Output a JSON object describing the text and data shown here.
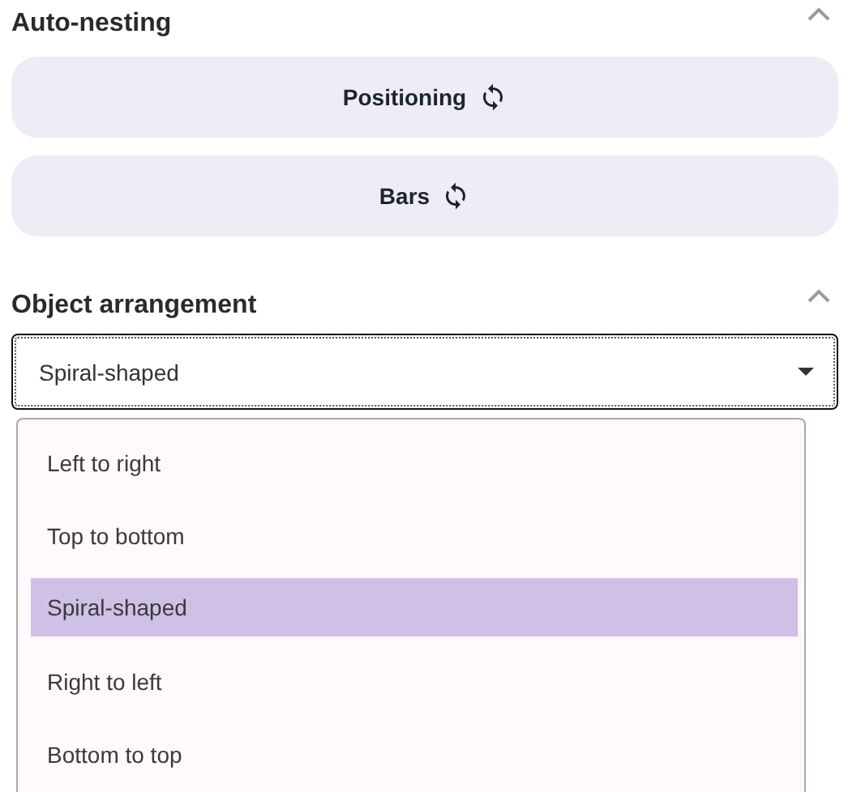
{
  "sections": [
    {
      "title": "Auto-nesting",
      "expanded": true,
      "kind": "buttons",
      "buttons": [
        {
          "label": "Positioning"
        },
        {
          "label": "Bars"
        }
      ]
    },
    {
      "title": "Object arrangement",
      "expanded": true,
      "kind": "select",
      "select": {
        "value": "Spiral-shaped",
        "open": true,
        "options": [
          {
            "label": "Left to right",
            "selected": false
          },
          {
            "label": "Top to bottom",
            "selected": false
          },
          {
            "label": "Spiral-shaped",
            "selected": true
          },
          {
            "label": "Right to left",
            "selected": false
          },
          {
            "label": "Bottom to top",
            "selected": false
          }
        ]
      }
    }
  ]
}
